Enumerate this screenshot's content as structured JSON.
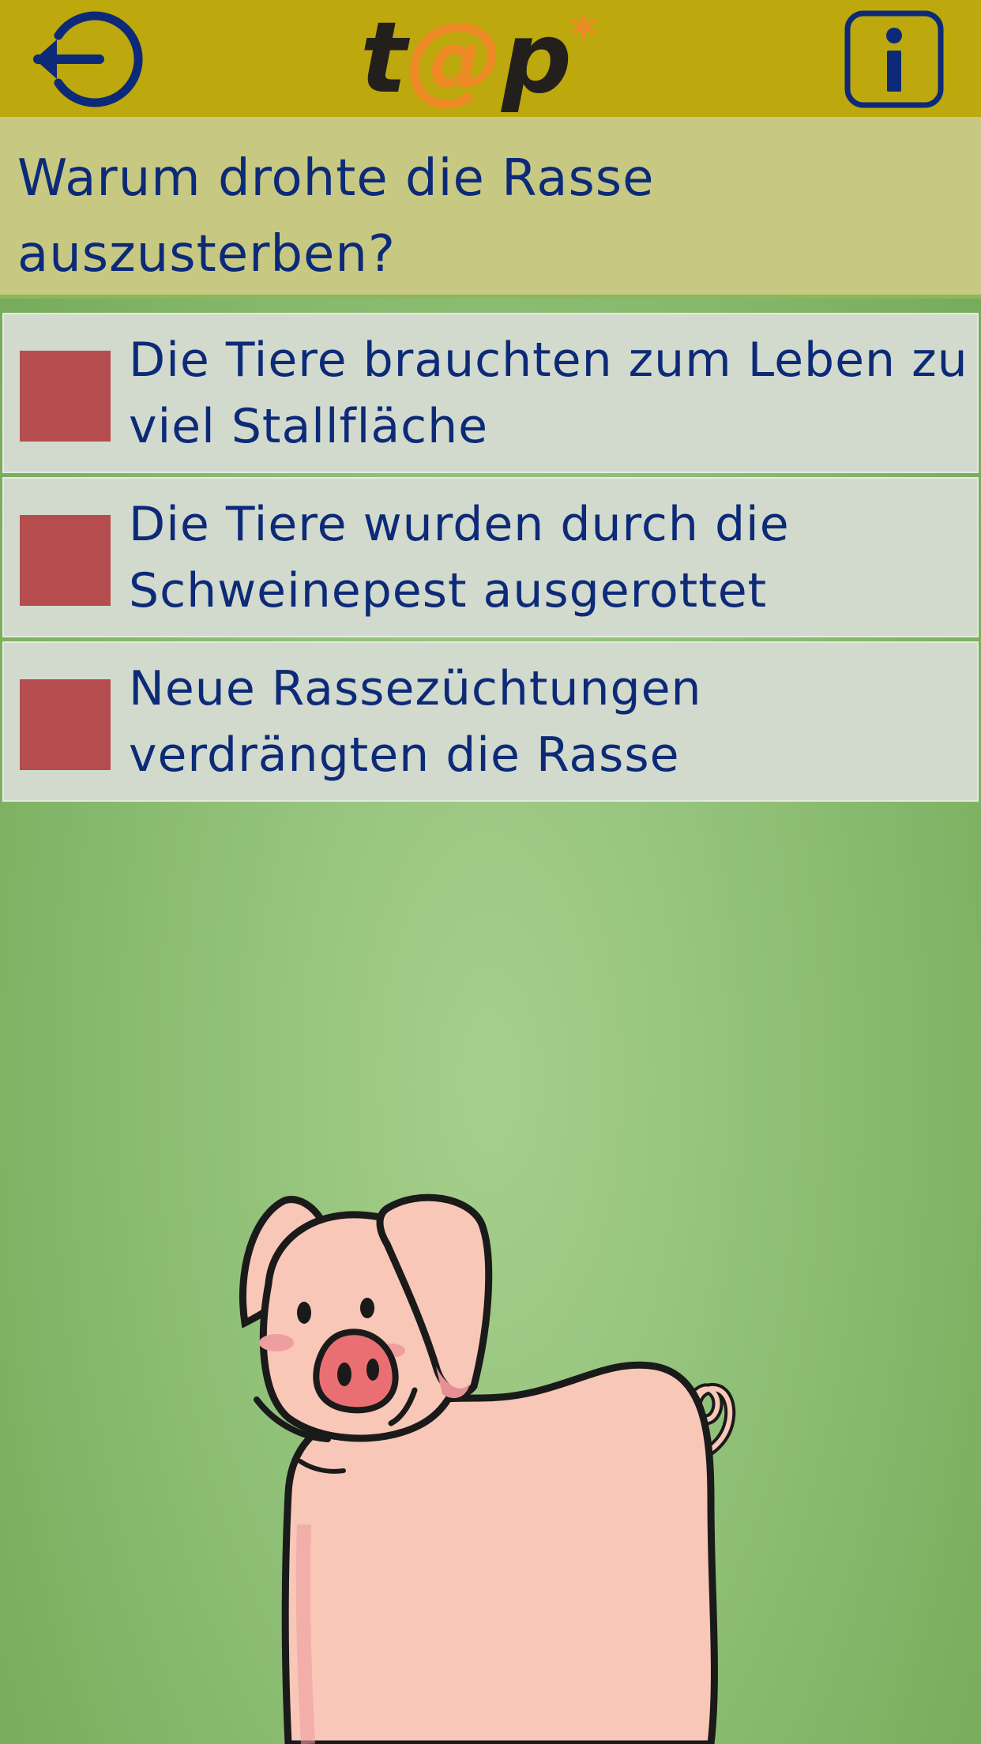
{
  "header": {
    "back_icon": "back-arrow-icon",
    "logo": {
      "t": "t",
      "at": "@",
      "p": "p",
      "star": "*"
    },
    "info_icon": "info-icon",
    "background_color": "#bda80d",
    "icon_color": "#0d2a78"
  },
  "quiz": {
    "question": "Warum drohte die Rasse auszusterben?",
    "answers": [
      {
        "label": "Die Tiere brauchten zum Leben zu viel Stallfläche"
      },
      {
        "label": "Die Tiere wurden durch die Schweinepest ausgerottet"
      },
      {
        "label": "Neue Rassezüchtungen verdrängten die Rasse"
      }
    ],
    "checkbox_color": "#b54d4f",
    "text_color": "#0d2a78"
  },
  "illustration": {
    "icon": "pig-illustration",
    "body_color": "#f8c7b8",
    "snout_color": "#ea6f72"
  }
}
